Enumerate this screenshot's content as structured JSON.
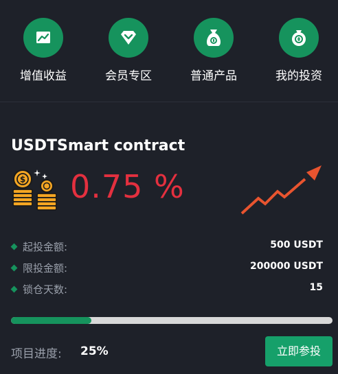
{
  "nav": {
    "items": [
      {
        "label": "增值收益",
        "icon": "chart-icon"
      },
      {
        "label": "会员专区",
        "icon": "diamond-icon"
      },
      {
        "label": "普通产品",
        "icon": "money-bag-icon"
      },
      {
        "label": "我的投资",
        "icon": "coin-bag-icon"
      }
    ]
  },
  "product": {
    "title": "USDTSmart contract",
    "rate": "0.75 %",
    "details": [
      {
        "label": "起投金额:",
        "value": "500 USDT"
      },
      {
        "label": "限投金额:",
        "value": "200000 USDT"
      },
      {
        "label": "锁仓天数:",
        "value": "15"
      }
    ],
    "progress_fraction": 0.25,
    "progress_label": "项目进度:",
    "progress_value": "25%",
    "action_label": "立即参投"
  },
  "colors": {
    "accent": "#16935d",
    "rate": "#e4303f",
    "background": "#1e2129",
    "trend": "#e8542f"
  }
}
